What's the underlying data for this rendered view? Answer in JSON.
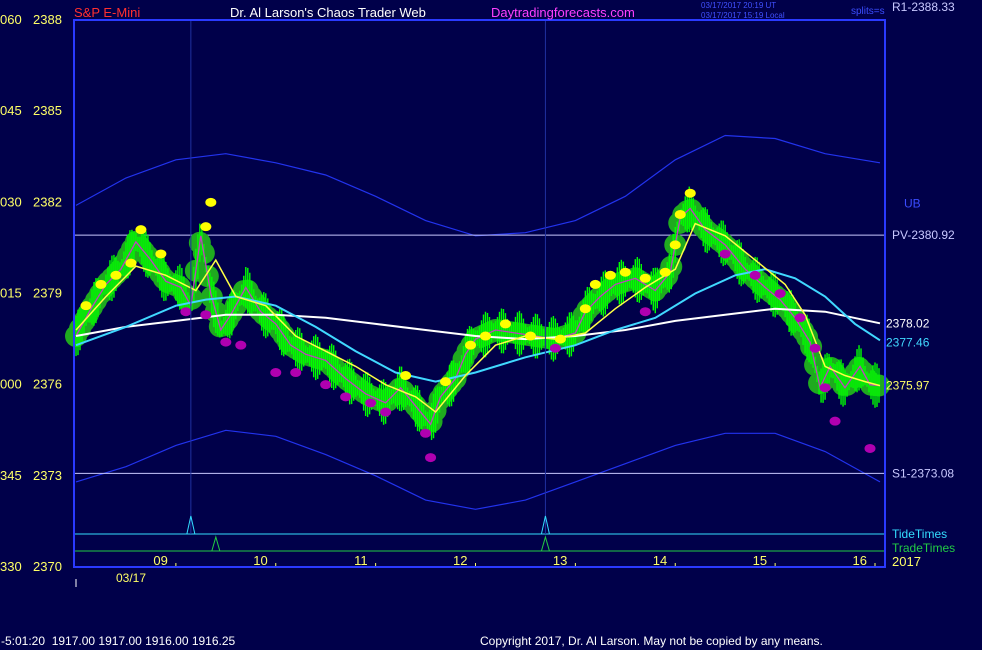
{
  "header": {
    "symbol": "S&P E-Mini",
    "title": "Dr. Al Larson's Chaos Trader Web",
    "site": "Daytradingforecasts.com",
    "time_utc": "03/17/2017 20:19 UT",
    "time_local": "03/17/2017 15:19 Local",
    "study": "splits=s"
  },
  "footer": {
    "status": "-5:01:20  1917.00 1917.00 1916.00 1916.25",
    "copyright": "Copyright 2017, Dr. Al Larson. May not be copied by any means."
  },
  "colors": {
    "background": "#00004a",
    "frame": "#2a3aff",
    "price_bar": "#00ff00",
    "glow": "#1faa1f",
    "yellow_dot": "#ffff00",
    "magenta_dot": "#b000b0",
    "ma_fast": "#ffff44",
    "ma_mid": "#40d8ff",
    "ma_slow": "#ffffff",
    "band": "#2233ee",
    "level": "#c8c8ff"
  },
  "chart_data": {
    "type": "line",
    "title": "S&P E-Mini",
    "ylim": [
      2370,
      2388
    ],
    "y_ticks": [
      {
        "left": "060",
        "price": "2388",
        "value": 2388
      },
      {
        "left": "045",
        "price": "2385",
        "value": 2385
      },
      {
        "left": "030",
        "price": "2382",
        "value": 2382
      },
      {
        "left": "015",
        "price": "2379",
        "value": 2379
      },
      {
        "left": "000",
        "price": "2376",
        "value": 2376
      },
      {
        "left": "345",
        "price": "2373",
        "value": 2373
      },
      {
        "left": "330",
        "price": "2370",
        "value": 2370
      }
    ],
    "xlim": [
      8.0,
      16.05
    ],
    "x_ticks": [
      {
        "label": "09",
        "value": 9
      },
      {
        "label": "10",
        "value": 10
      },
      {
        "label": "11",
        "value": 11
      },
      {
        "label": "12",
        "value": 12
      },
      {
        "label": "13",
        "value": 13
      },
      {
        "label": "14",
        "value": 14
      },
      {
        "label": "15",
        "value": 15
      },
      {
        "label": "16",
        "value": 16
      }
    ],
    "date_label": "03/17",
    "year_label": "2017",
    "levels": [
      {
        "name": "R1",
        "label": "R1-2388.33",
        "value": 2388.33
      },
      {
        "name": "PV",
        "label": "PV-2380.92",
        "value": 2380.92
      },
      {
        "name": "S1",
        "label": "S1-2373.08",
        "value": 2373.08
      }
    ],
    "band_label": "UB",
    "series": [
      {
        "name": "price",
        "label": "2375.97",
        "x": [
          8.0,
          8.15,
          8.3,
          8.45,
          8.6,
          8.75,
          8.9,
          9.05,
          9.15,
          9.25,
          9.35,
          9.45,
          9.55,
          9.7,
          9.85,
          10.0,
          10.15,
          10.3,
          10.5,
          10.7,
          10.9,
          11.1,
          11.25,
          11.4,
          11.55,
          11.65,
          11.8,
          11.9,
          12.0,
          12.2,
          12.4,
          12.6,
          12.8,
          13.0,
          13.1,
          13.25,
          13.4,
          13.6,
          13.8,
          13.95,
          14.05,
          14.15,
          14.3,
          14.5,
          14.7,
          14.9,
          15.05,
          15.2,
          15.35,
          15.45,
          15.55,
          15.7,
          15.85,
          15.95,
          16.05
        ],
        "y": [
          2377.6,
          2378.5,
          2379.3,
          2379.8,
          2380.7,
          2380.1,
          2379.4,
          2379.2,
          2378.6,
          2380.9,
          2379.0,
          2377.8,
          2378.3,
          2379.2,
          2378.4,
          2378.0,
          2377.3,
          2377.0,
          2376.8,
          2376.2,
          2375.7,
          2375.4,
          2375.9,
          2375.3,
          2374.7,
          2375.6,
          2376.2,
          2377.0,
          2377.5,
          2377.8,
          2377.7,
          2377.6,
          2377.5,
          2377.7,
          2378.4,
          2378.9,
          2379.3,
          2379.5,
          2379.1,
          2379.7,
          2381.5,
          2381.8,
          2381.1,
          2380.6,
          2379.8,
          2379.2,
          2378.8,
          2378.2,
          2377.4,
          2375.9,
          2376.6,
          2375.9,
          2376.6,
          2376.0,
          2375.97
        ]
      },
      {
        "name": "fast average",
        "x": [
          8.0,
          8.3,
          8.6,
          8.9,
          9.2,
          9.4,
          9.6,
          9.9,
          10.2,
          10.5,
          10.8,
          11.1,
          11.4,
          11.6,
          11.9,
          12.2,
          12.5,
          12.8,
          13.1,
          13.4,
          13.7,
          14.0,
          14.2,
          14.5,
          14.8,
          15.1,
          15.3,
          15.5,
          15.7,
          15.9,
          16.05
        ],
        "y": [
          2377.8,
          2378.9,
          2379.9,
          2379.6,
          2379.1,
          2380.1,
          2378.9,
          2378.6,
          2377.6,
          2377.1,
          2376.6,
          2376.0,
          2375.6,
          2375.1,
          2376.3,
          2377.3,
          2377.6,
          2377.5,
          2377.7,
          2378.5,
          2379.2,
          2379.8,
          2381.3,
          2380.9,
          2380.1,
          2379.3,
          2378.3,
          2376.6,
          2376.3,
          2376.1,
          2375.97
        ]
      },
      {
        "name": "mid average",
        "label": "2377.46",
        "x": [
          8.0,
          8.5,
          9.0,
          9.3,
          9.6,
          10.0,
          10.4,
          10.8,
          11.2,
          11.6,
          12.0,
          12.5,
          13.0,
          13.4,
          13.8,
          14.2,
          14.6,
          14.9,
          15.2,
          15.5,
          15.8,
          16.05
        ],
        "y": [
          2377.3,
          2377.9,
          2378.6,
          2378.8,
          2378.9,
          2378.6,
          2377.9,
          2377.1,
          2376.4,
          2376.1,
          2376.4,
          2376.9,
          2377.3,
          2377.8,
          2378.2,
          2379.0,
          2379.6,
          2379.8,
          2379.5,
          2378.9,
          2378.0,
          2377.46
        ]
      },
      {
        "name": "slow average",
        "label": "2378.02",
        "x": [
          8.0,
          8.5,
          9.0,
          9.5,
          10.0,
          10.5,
          11.0,
          11.5,
          12.0,
          12.5,
          13.0,
          13.5,
          14.0,
          14.5,
          15.0,
          15.5,
          16.05
        ],
        "y": [
          2377.6,
          2377.9,
          2378.1,
          2378.3,
          2378.3,
          2378.2,
          2378.0,
          2377.8,
          2377.6,
          2377.5,
          2377.6,
          2377.8,
          2378.1,
          2378.3,
          2378.5,
          2378.4,
          2378.02
        ]
      },
      {
        "name": "upper band",
        "x": [
          8.0,
          8.5,
          9.0,
          9.5,
          10.0,
          10.5,
          11.0,
          11.5,
          12.0,
          12.5,
          13.0,
          13.5,
          14.0,
          14.5,
          15.0,
          15.5,
          16.05
        ],
        "y": [
          2381.9,
          2382.8,
          2383.4,
          2383.6,
          2383.3,
          2382.9,
          2382.2,
          2381.4,
          2380.9,
          2381.0,
          2381.4,
          2382.2,
          2383.4,
          2384.2,
          2384.1,
          2383.6,
          2383.3
        ]
      },
      {
        "name": "lower band",
        "x": [
          8.0,
          8.5,
          9.0,
          9.5,
          10.0,
          10.5,
          11.0,
          11.5,
          12.0,
          12.5,
          13.0,
          13.5,
          14.0,
          14.5,
          15.0,
          15.5,
          16.05
        ],
        "y": [
          2372.8,
          2373.3,
          2374.0,
          2374.5,
          2374.3,
          2373.7,
          2373.0,
          2372.2,
          2371.9,
          2372.2,
          2372.8,
          2373.4,
          2374.0,
          2374.4,
          2374.4,
          2373.8,
          2372.8
        ]
      }
    ],
    "tide_times": {
      "label": "TideTimes",
      "x": [
        9.15,
        12.7
      ]
    },
    "trade_times": {
      "label": "TradeTimes",
      "x": [
        9.4,
        12.7
      ]
    },
    "dots": {
      "yellow": [
        [
          8.1,
          2378.6
        ],
        [
          8.25,
          2379.3
        ],
        [
          8.4,
          2379.6
        ],
        [
          8.55,
          2380.0
        ],
        [
          8.65,
          2381.1
        ],
        [
          8.85,
          2380.3
        ],
        [
          9.3,
          2381.2
        ],
        [
          9.35,
          2382.0
        ],
        [
          11.3,
          2376.3
        ],
        [
          11.7,
          2376.1
        ],
        [
          11.95,
          2377.3
        ],
        [
          12.1,
          2377.6
        ],
        [
          12.3,
          2378.0
        ],
        [
          12.55,
          2377.6
        ],
        [
          12.85,
          2377.5
        ],
        [
          13.1,
          2378.5
        ],
        [
          13.2,
          2379.3
        ],
        [
          13.35,
          2379.6
        ],
        [
          13.5,
          2379.7
        ],
        [
          13.7,
          2379.5
        ],
        [
          13.9,
          2379.7
        ],
        [
          14.0,
          2380.6
        ],
        [
          14.05,
          2381.6
        ],
        [
          14.15,
          2382.3
        ]
      ],
      "magenta": [
        [
          9.1,
          2378.4
        ],
        [
          9.3,
          2378.3
        ],
        [
          9.5,
          2377.4
        ],
        [
          9.65,
          2377.3
        ],
        [
          10.0,
          2376.4
        ],
        [
          10.2,
          2376.4
        ],
        [
          10.5,
          2376.0
        ],
        [
          10.7,
          2375.6
        ],
        [
          10.95,
          2375.4
        ],
        [
          11.1,
          2375.1
        ],
        [
          11.5,
          2374.4
        ],
        [
          11.55,
          2373.6
        ],
        [
          12.8,
          2377.2
        ],
        [
          13.7,
          2378.4
        ],
        [
          14.5,
          2380.3
        ],
        [
          14.8,
          2379.6
        ],
        [
          15.05,
          2379.0
        ],
        [
          15.25,
          2378.2
        ],
        [
          15.4,
          2377.2
        ],
        [
          15.5,
          2375.9
        ],
        [
          15.6,
          2374.8
        ],
        [
          15.95,
          2373.9
        ]
      ]
    }
  }
}
